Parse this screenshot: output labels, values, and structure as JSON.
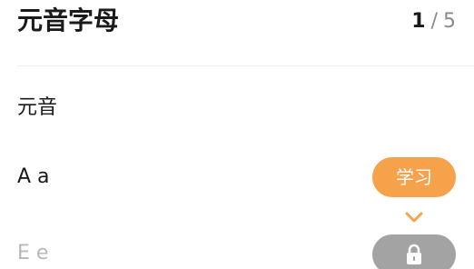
{
  "header": {
    "title": "元音字母",
    "page_current": "1",
    "page_separator": "/",
    "page_total": "5"
  },
  "section": {
    "label": "元音"
  },
  "items": [
    {
      "label": "A a",
      "status": "unlocked",
      "button_label": "学习"
    },
    {
      "label": "E e",
      "status": "locked"
    }
  ],
  "icons": {
    "next": "chevron-down-icon",
    "locked": "lock-icon"
  },
  "colors": {
    "accent": "#f6a24b",
    "locked": "#a3a3a3",
    "disabled_text": "#b8b8b8"
  }
}
